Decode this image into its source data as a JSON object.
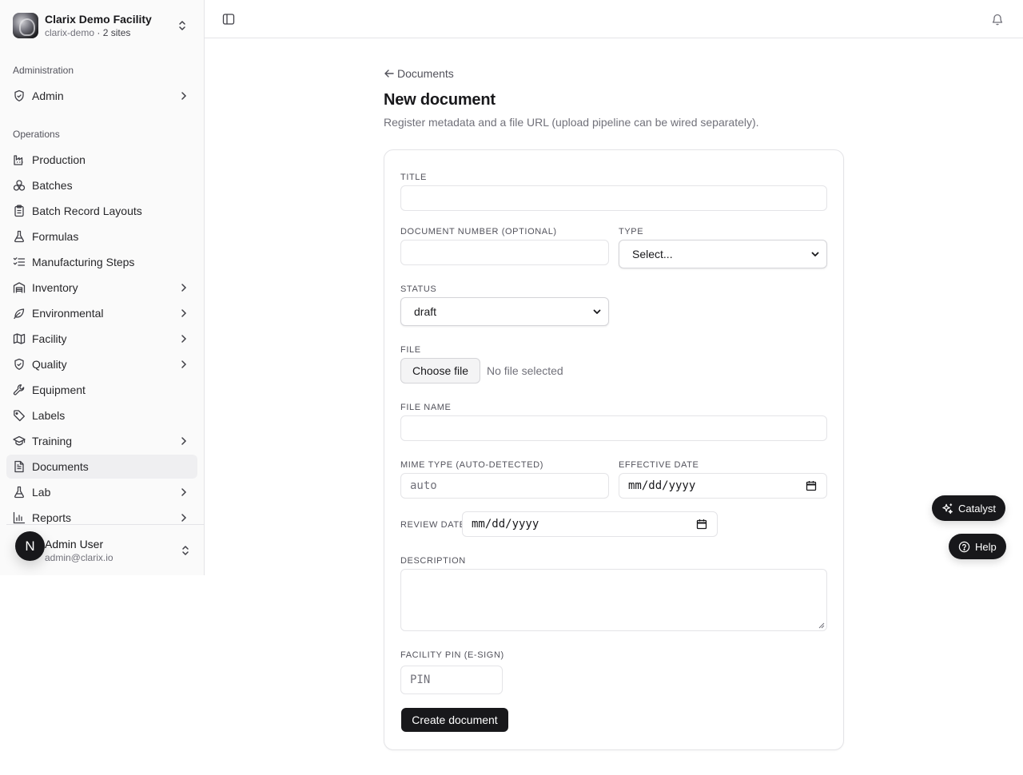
{
  "org": {
    "name": "Clarix Demo Facility",
    "slug": "clarix-demo",
    "sites": "· 2 sites"
  },
  "sidebar": {
    "groups": [
      {
        "label": "Administration"
      },
      {
        "label": "Operations"
      }
    ],
    "items": [
      {
        "label": "Admin",
        "icon": "shield-check-icon",
        "expandable": true
      },
      {
        "label": "Production",
        "icon": "factory-icon",
        "expandable": false
      },
      {
        "label": "Batches",
        "icon": "boxes-icon",
        "expandable": false
      },
      {
        "label": "Batch Record Layouts",
        "icon": "clipboard-icon",
        "expandable": false
      },
      {
        "label": "Formulas",
        "icon": "flask-icon",
        "expandable": false
      },
      {
        "label": "Manufacturing Steps",
        "icon": "list-checks-icon",
        "expandable": false
      },
      {
        "label": "Inventory",
        "icon": "warehouse-icon",
        "expandable": true
      },
      {
        "label": "Environmental",
        "icon": "leaf-icon",
        "expandable": true
      },
      {
        "label": "Facility",
        "icon": "map-icon",
        "expandable": true
      },
      {
        "label": "Quality",
        "icon": "shield-check-icon",
        "expandable": true
      },
      {
        "label": "Equipment",
        "icon": "wrench-icon",
        "expandable": false
      },
      {
        "label": "Labels",
        "icon": "tag-icon",
        "expandable": false
      },
      {
        "label": "Training",
        "icon": "graduation-cap-icon",
        "expandable": true
      },
      {
        "label": "Documents",
        "icon": "file-text-icon",
        "expandable": false,
        "active": true
      },
      {
        "label": "Lab",
        "icon": "flask-icon",
        "expandable": true
      },
      {
        "label": "Reports",
        "icon": "bar-chart-icon",
        "expandable": true
      }
    ]
  },
  "user": {
    "initial": "N",
    "name": "Admin User",
    "email": "admin@clarix.io"
  },
  "page": {
    "back_label": "Documents",
    "title": "New document",
    "description": "Register metadata and a file URL (upload pipeline can be wired separately)."
  },
  "form": {
    "title_label": "TITLE",
    "title_value": "",
    "doc_number_label": "DOCUMENT NUMBER (OPTIONAL)",
    "doc_number_value": "",
    "type_label": "TYPE",
    "type_selected": "Select...",
    "status_label": "STATUS",
    "status_selected": "draft",
    "file_label": "FILE",
    "file_button": "Choose file",
    "file_status": "No file selected",
    "file_name_label": "FILE NAME",
    "file_name_value": "",
    "mime_label": "MIME TYPE (AUTO-DETECTED)",
    "mime_placeholder": "auto",
    "effective_date_label": "EFFECTIVE DATE",
    "effective_date_placeholder": "mm/dd/yyyy",
    "review_date_label": "REVIEW DATE",
    "review_date_placeholder": "mm/dd/yyyy",
    "description_label": "DESCRIPTION",
    "description_value": "",
    "pin_label": "FACILITY PIN (E-SIGN)",
    "pin_placeholder": "PIN",
    "submit_label": "Create document"
  },
  "floating": {
    "catalyst_label": "Catalyst",
    "help_label": "Help"
  }
}
